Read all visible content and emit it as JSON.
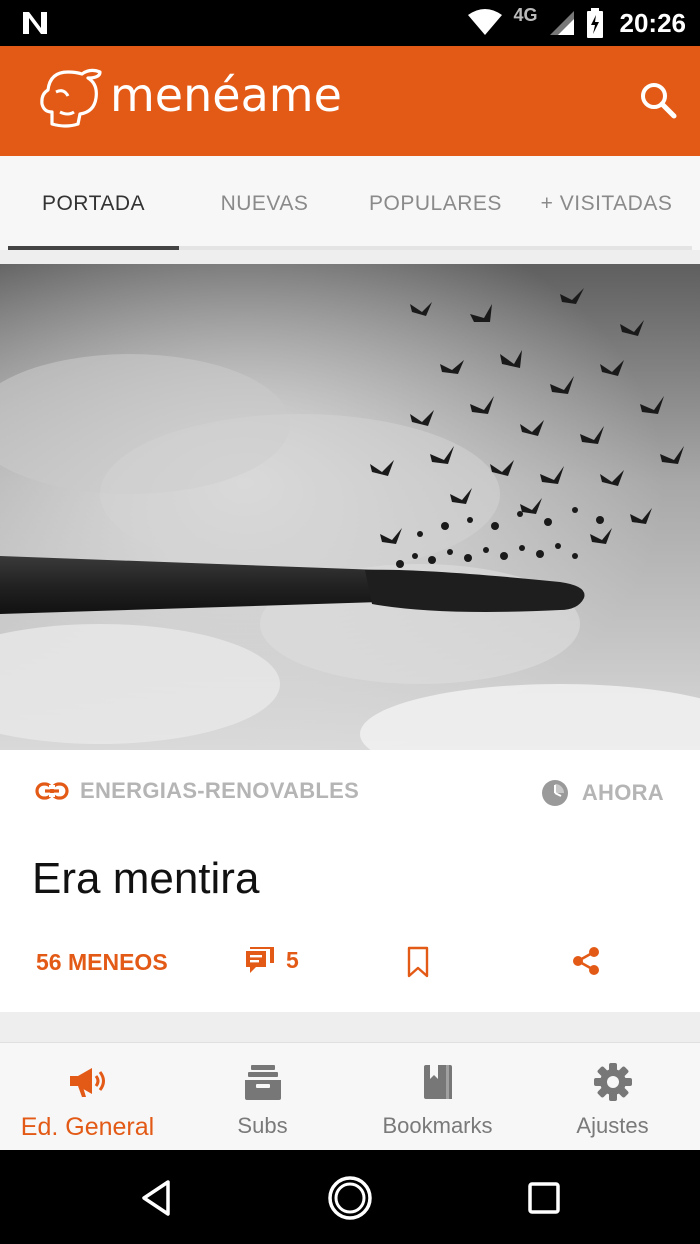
{
  "status_bar": {
    "network": "4G",
    "time": "20:26"
  },
  "app_bar": {
    "logo_text": "menéame",
    "brand_color": "#e35a16"
  },
  "tabs": [
    {
      "label": "PORTADA",
      "active": true
    },
    {
      "label": "NUEVAS",
      "active": false
    },
    {
      "label": "POPULARES",
      "active": false
    },
    {
      "label": "+ VISITADAS",
      "active": false
    }
  ],
  "story": {
    "category": "ENERGIAS-RENOVABLES",
    "time": "AHORA",
    "title": "Era mentira",
    "meneos": "56 MENEOS",
    "comments": "5"
  },
  "bottom_nav": [
    {
      "label": "Ed. General",
      "icon": "megaphone-icon",
      "active": true
    },
    {
      "label": "Subs",
      "icon": "inbox-icon",
      "active": false
    },
    {
      "label": "Bookmarks",
      "icon": "book-icon",
      "active": false
    },
    {
      "label": "Ajustes",
      "icon": "gear-icon",
      "active": false
    }
  ]
}
